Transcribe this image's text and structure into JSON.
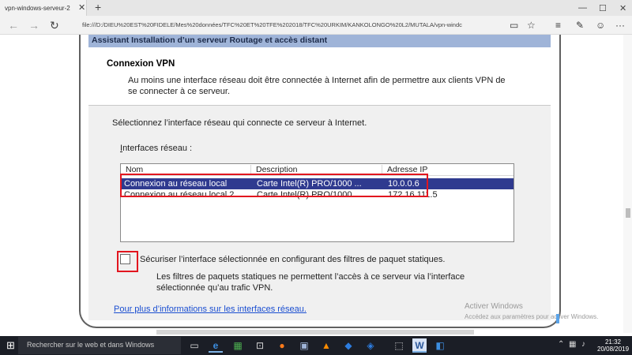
{
  "browser": {
    "tab_title": "vpn-windows-serveur-2",
    "tab_close": "✕",
    "new_tab": "+",
    "url": "file:///D:/DIEU%20EST%20FIDELE/Mes%20données/TFC%20ET%20TFE%202018/TFC%20URKIM/KANKOLONGO%20L2/MUTALA/vpn-windc"
  },
  "dialog": {
    "title": "Assistant Installation d’un serveur Routage et accès distant",
    "header_title": "Connexion VPN",
    "header_desc": "Au moins une interface réseau doit être connectée à Internet afin de permettre aux clients VPN de se connecter à ce serveur.",
    "instruction": "Sélectionnez l’interface réseau qui connecte ce serveur à Internet.",
    "interfaces_label_accel": "I",
    "interfaces_label_rest": "nterfaces réseau :",
    "columns": [
      "Nom",
      "Description",
      "Adresse IP"
    ],
    "rows": [
      {
        "name": "Connexion au réseau local",
        "desc": "Carte Intel(R) PRO/1000 ...",
        "ip": "10.0.0.6"
      },
      {
        "name": "Connexion au réseau local 2",
        "desc": "Carte Intel(R) PRO/1000 ...",
        "ip": "172.16.111.5"
      }
    ],
    "checkbox_label": "Sécuriser l’interface sélectionnée en configurant des filtres de paquet statiques.",
    "checkbox_desc": "Les filtres de paquets statiques ne permettent l’accès à ce serveur via l’interface sélectionnée qu’au trafic VPN.",
    "more_link": "Pour plus d’informations sur les interfaces réseau."
  },
  "watermark": {
    "line1": "Activer Windows",
    "line2": "Accédez aux paramètres pour activer Windows."
  },
  "taskbar": {
    "search_placeholder": "Rechercher sur le web et dans Windows",
    "time": "21:32",
    "date": "20/08/2019"
  }
}
